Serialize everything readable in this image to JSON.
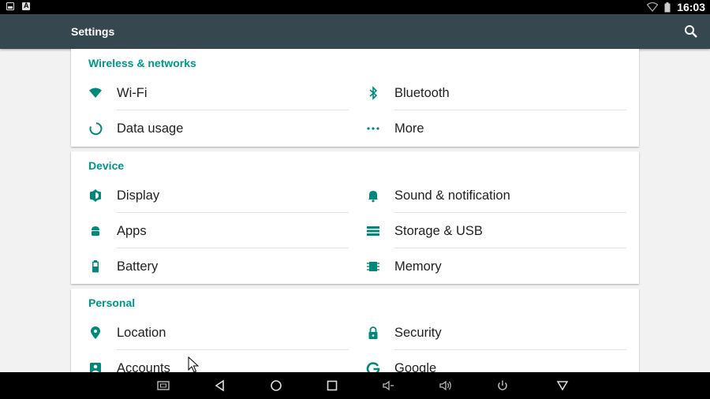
{
  "status_bar": {
    "time": "16:03"
  },
  "app_bar": {
    "title": "Settings"
  },
  "sections": [
    {
      "title": "Wireless & networks",
      "items": [
        {
          "label": "Wi-Fi",
          "icon": "wifi-icon"
        },
        {
          "label": "Bluetooth",
          "icon": "bluetooth-icon"
        },
        {
          "label": "Data usage",
          "icon": "data-usage-icon"
        },
        {
          "label": "More",
          "icon": "more-dots-icon"
        }
      ]
    },
    {
      "title": "Device",
      "items": [
        {
          "label": "Display",
          "icon": "display-brightness-icon"
        },
        {
          "label": "Sound & notification",
          "icon": "bell-icon"
        },
        {
          "label": "Apps",
          "icon": "android-apps-icon"
        },
        {
          "label": "Storage & USB",
          "icon": "storage-icon"
        },
        {
          "label": "Battery",
          "icon": "battery-icon"
        },
        {
          "label": "Memory",
          "icon": "memory-chip-icon"
        }
      ]
    },
    {
      "title": "Personal",
      "items": [
        {
          "label": "Location",
          "icon": "location-pin-icon"
        },
        {
          "label": "Security",
          "icon": "lock-icon"
        },
        {
          "label": "Accounts",
          "icon": "accounts-icon"
        },
        {
          "label": "Google",
          "icon": "google-icon"
        }
      ]
    }
  ],
  "colors": {
    "accent": "#009688",
    "app_bar": "#37474f",
    "icon_tint": "#00897b"
  }
}
